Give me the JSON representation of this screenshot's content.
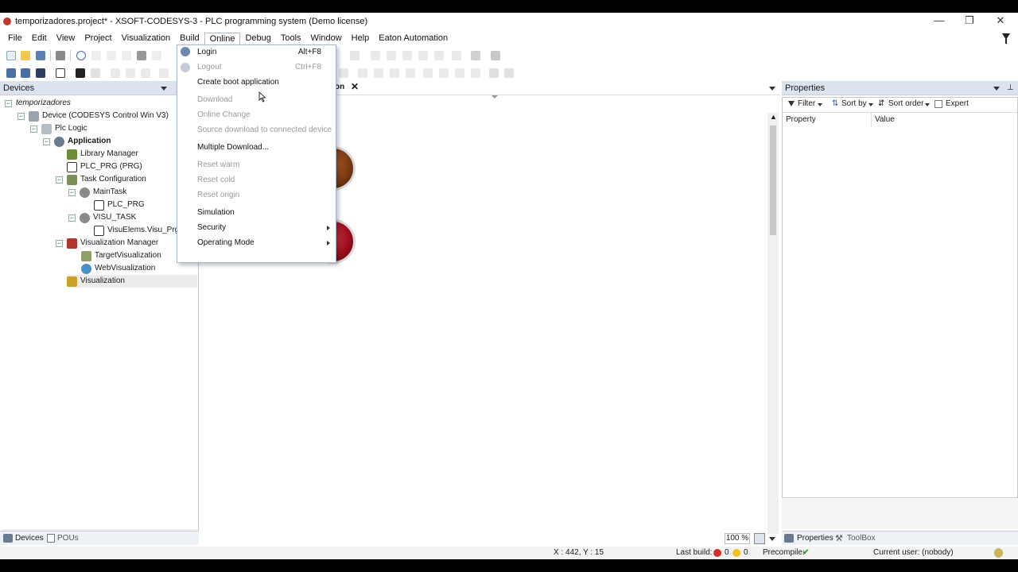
{
  "window": {
    "title": "temporizadores.project* - XSOFT-CODESYS-3 - PLC programming system (Demo license)",
    "minimize": "—",
    "maximize": "❐",
    "close": "✕"
  },
  "menubar": {
    "items": [
      "File",
      "Edit",
      "View",
      "Project",
      "Visualization",
      "Build",
      "Online",
      "Debug",
      "Tools",
      "Window",
      "Help",
      "Eaton Automation"
    ],
    "open_item": "Online"
  },
  "online_menu": {
    "items": [
      {
        "label": "Login",
        "shortcut": "Alt+F8",
        "enabled": true
      },
      {
        "label": "Logout",
        "shortcut": "Ctrl+F8",
        "enabled": false
      },
      {
        "label": "Create boot application",
        "shortcut": "",
        "enabled": true
      },
      {
        "label": "Download",
        "shortcut": "",
        "enabled": false
      },
      {
        "label": "Online Change",
        "shortcut": "",
        "enabled": false
      },
      {
        "label": "Source download to connected device",
        "shortcut": "",
        "enabled": false
      },
      {
        "label": "Multiple Download...",
        "shortcut": "",
        "enabled": true
      },
      {
        "label": "Reset warm",
        "shortcut": "",
        "enabled": false
      },
      {
        "label": "Reset cold",
        "shortcut": "",
        "enabled": false
      },
      {
        "label": "Reset origin",
        "shortcut": "",
        "enabled": false
      },
      {
        "label": "Simulation",
        "shortcut": "",
        "enabled": true
      },
      {
        "label": "Security",
        "shortcut": "",
        "enabled": true,
        "submenu": true
      },
      {
        "label": "Operating Mode",
        "shortcut": "",
        "enabled": true,
        "submenu": true
      }
    ]
  },
  "devices_panel": {
    "title": "Devices",
    "tree": [
      {
        "label": "temporizadores",
        "italic": true
      },
      {
        "label": "Device (CODESYS Control Win V3)"
      },
      {
        "label": "Plc Logic"
      },
      {
        "label": "Application",
        "bold": true
      },
      {
        "label": "Library Manager"
      },
      {
        "label": "PLC_PRG (PRG)"
      },
      {
        "label": "Task Configuration"
      },
      {
        "label": "MainTask"
      },
      {
        "label": "PLC_PRG"
      },
      {
        "label": "VISU_TASK"
      },
      {
        "label": "VisuElems.Visu_Prg"
      },
      {
        "label": "Visualization Manager"
      },
      {
        "label": "TargetVisualization"
      },
      {
        "label": "WebVisualization"
      },
      {
        "label": "Visualization",
        "selected": true
      }
    ],
    "bottom_tabs": [
      "Devices",
      "POUs"
    ]
  },
  "editor": {
    "tab_label": "on",
    "zoom": "100 %"
  },
  "properties_panel": {
    "title": "Properties",
    "filter_label": "Filter",
    "sort_by_label": "Sort by",
    "sort_order_label": "Sort order",
    "expert_label": "Expert",
    "col_property": "Property",
    "col_value": "Value",
    "bottom_tabs": [
      "Properties",
      "ToolBox"
    ]
  },
  "statusbar": {
    "coords": "X : 442, Y : 15",
    "last_build_label": "Last build:",
    "errors": "0",
    "warnings": "0",
    "precompile_label": "Precompile:",
    "current_user": "Current user: (nobody)"
  },
  "colors": {
    "panel_header": "#dbe3ee",
    "menu_border": "#a9b8cc",
    "disabled_text": "#9a9a9a",
    "lamp_brown": "#7a3a12",
    "lamp_red": "#9b0d1c"
  }
}
